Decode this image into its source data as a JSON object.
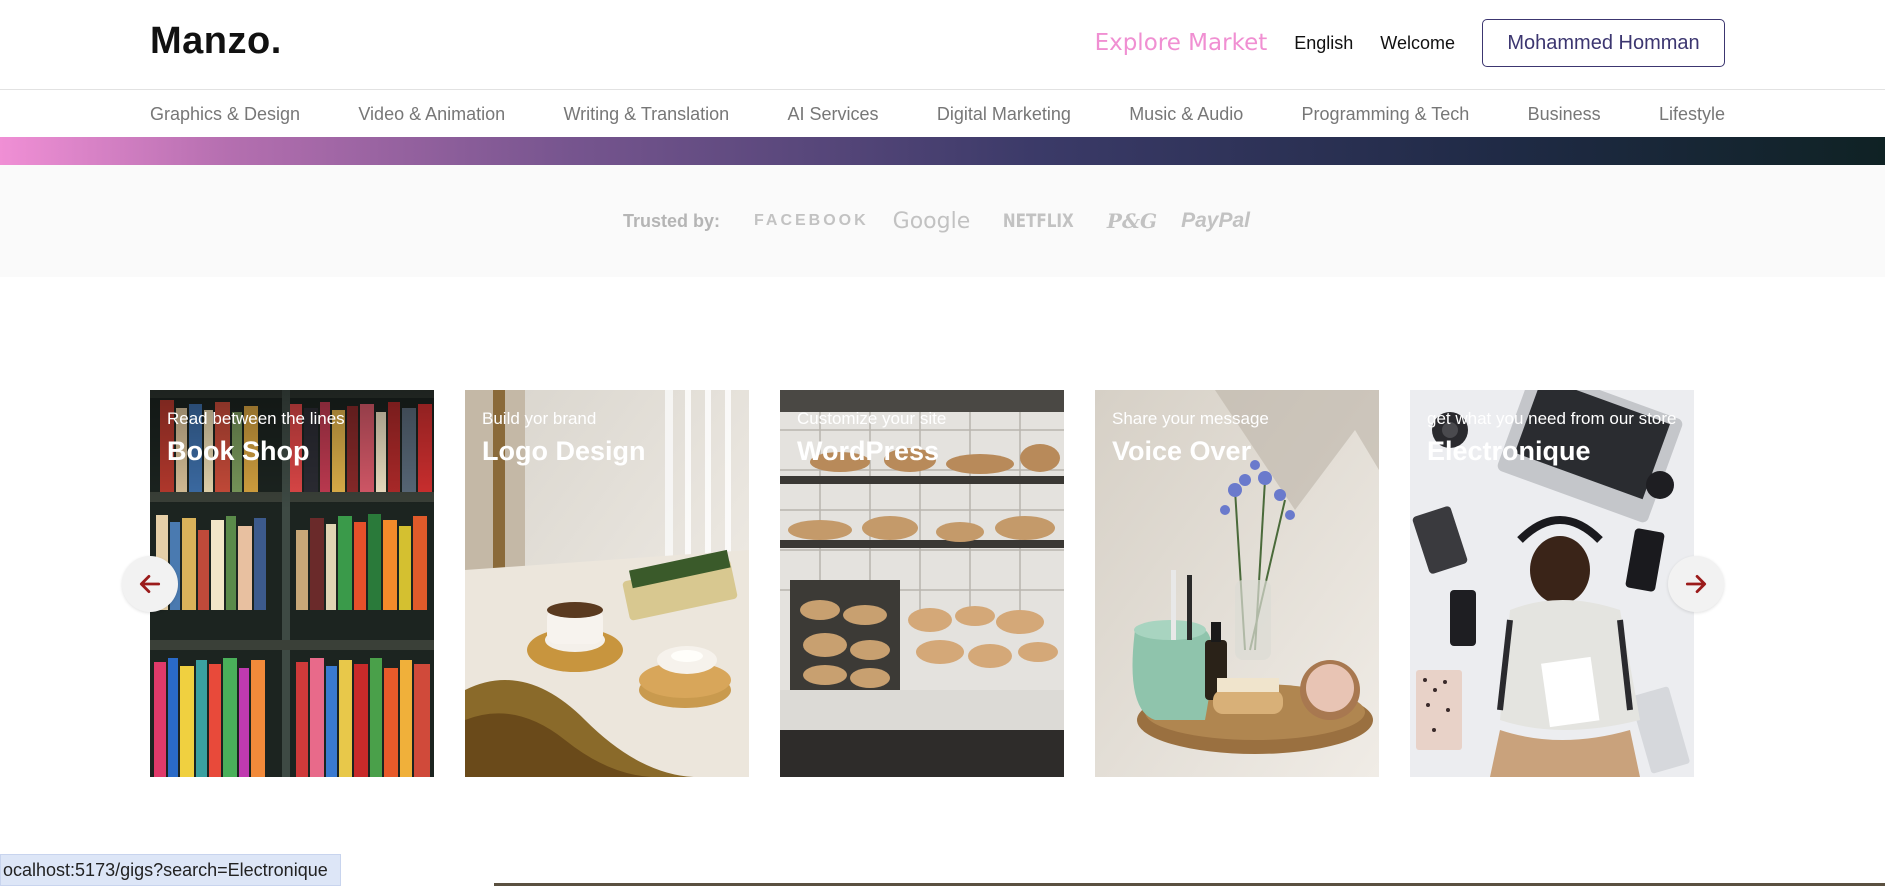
{
  "header": {
    "logo": "Manzo.",
    "explore": "Explore Market",
    "language": "English",
    "welcome": "Welcome",
    "user": "Mohammed Homman"
  },
  "categories": [
    "Graphics & Design",
    "Video & Animation",
    "Writing & Translation",
    "AI Services",
    "Digital Marketing",
    "Music & Audio",
    "Programming & Tech",
    "Business",
    "Lifestyle"
  ],
  "trusted": {
    "label": "Trusted by:",
    "brands": [
      "FACEBOOK",
      "Google",
      "NETFLIX",
      "P&G",
      "PayPal"
    ]
  },
  "cards": [
    {
      "desc": "Read between the lines",
      "title": "Book Shop"
    },
    {
      "desc": "Build yor brand",
      "title": "Logo Design"
    },
    {
      "desc": "Customize your site",
      "title": "WordPress"
    },
    {
      "desc": "Share your message",
      "title": "Voice Over"
    },
    {
      "desc": "get what you need from our store",
      "title": "Electronique"
    }
  ],
  "status_url": "ocalhost:5173/gigs?search=Electronique",
  "colors": {
    "accent_pink": "#f08fd2",
    "brand_purple": "#3c3670",
    "arrow_red": "#9b1b1b"
  },
  "icons": {
    "left_arrow": "arrow-left-icon",
    "right_arrow": "arrow-right-icon"
  }
}
